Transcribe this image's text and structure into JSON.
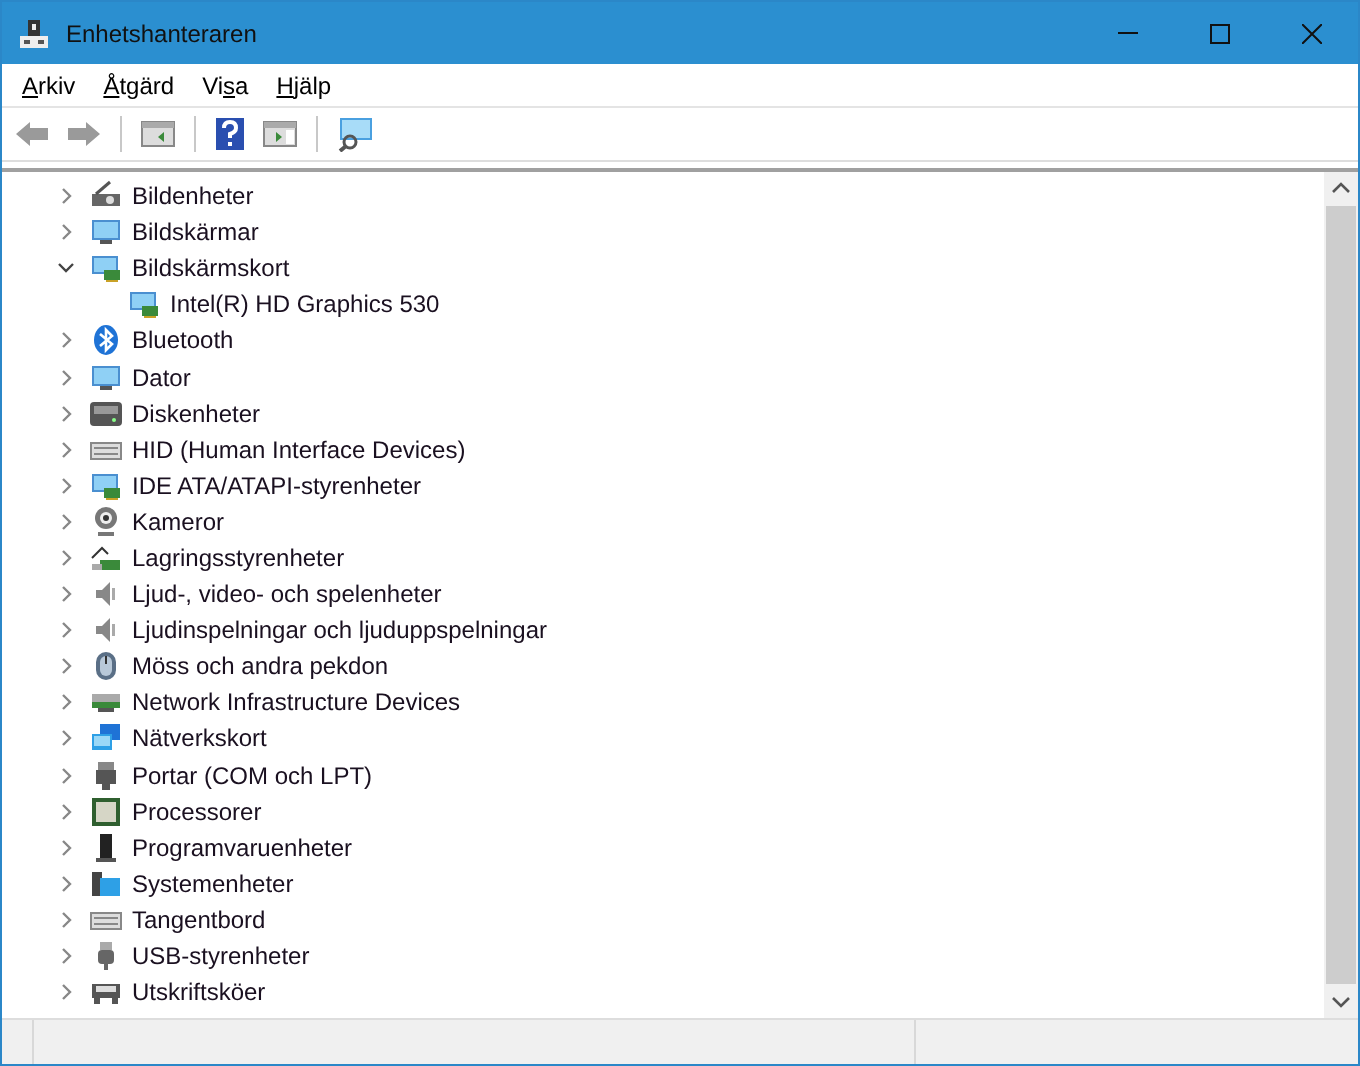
{
  "window": {
    "title": "Enhetshanteraren"
  },
  "menu": [
    {
      "key": "A",
      "post": "rkiv"
    },
    {
      "key": "Å",
      "post": "tgärd"
    },
    {
      "pre": "Vi",
      "key": "s",
      "post": "a"
    },
    {
      "key": "H",
      "post": "jälp"
    }
  ],
  "tree": [
    {
      "label": "Bildenheter",
      "expanded": false
    },
    {
      "label": "Bildskärmar",
      "expanded": false
    },
    {
      "label": "Bildskärmskort",
      "expanded": true,
      "children": [
        {
          "label": "Intel(R) HD Graphics 530"
        }
      ]
    },
    {
      "label": "Bluetooth",
      "expanded": false
    },
    {
      "label": "Dator",
      "expanded": false
    },
    {
      "label": "Diskenheter",
      "expanded": false
    },
    {
      "label": "HID (Human Interface Devices)",
      "expanded": false
    },
    {
      "label": "IDE ATA/ATAPI-styrenheter",
      "expanded": false
    },
    {
      "label": "Kameror",
      "expanded": false
    },
    {
      "label": "Lagringsstyrenheter",
      "expanded": false
    },
    {
      "label": "Ljud-, video- och spelenheter",
      "expanded": false
    },
    {
      "label": "Ljudinspelningar och ljuduppspelningar",
      "expanded": false
    },
    {
      "label": "Möss och andra pekdon",
      "expanded": false
    },
    {
      "label": "Network Infrastructure Devices",
      "expanded": false
    },
    {
      "label": "Nätverkskort",
      "expanded": false
    },
    {
      "label": "Portar (COM och LPT)",
      "expanded": false
    },
    {
      "label": "Processorer",
      "expanded": false
    },
    {
      "label": "Programvaruenheter",
      "expanded": false
    },
    {
      "label": "Systemenheter",
      "expanded": false
    },
    {
      "label": "Tangentbord",
      "expanded": false
    },
    {
      "label": "USB-styrenheter",
      "expanded": false
    },
    {
      "label": "Utskriftsköer",
      "expanded": false
    }
  ]
}
